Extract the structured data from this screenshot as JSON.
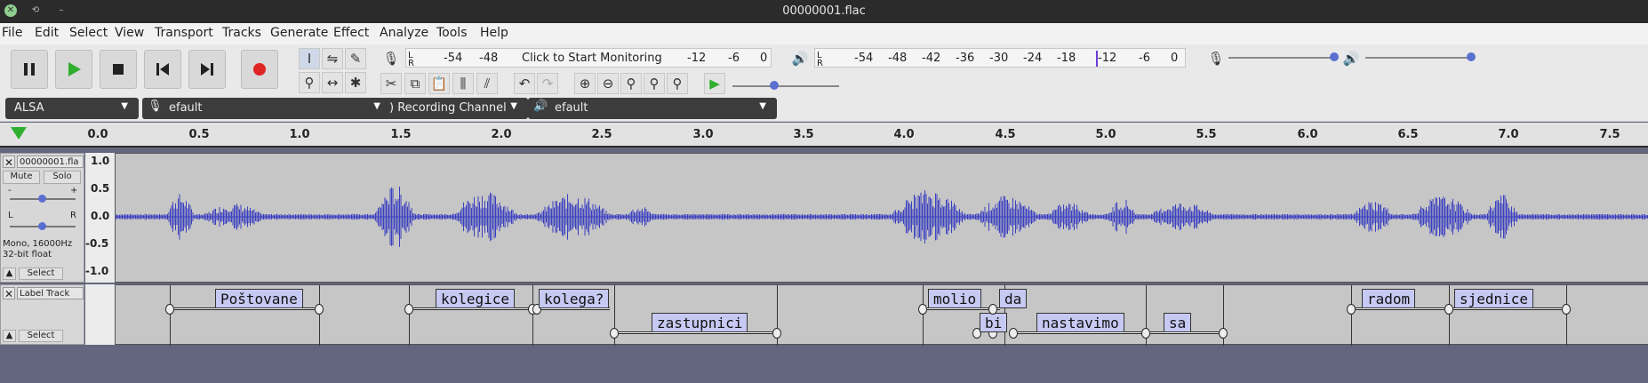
{
  "window": {
    "title": "00000001.flac"
  },
  "menu": [
    "File",
    "Edit",
    "Select",
    "View",
    "Transport",
    "Tracks",
    "Generate",
    "Effect",
    "Analyze",
    "Tools",
    "Help"
  ],
  "meters": {
    "record_prompt": "Click to Start Monitoring",
    "record_ticks": [
      "-54",
      "-48",
      "-12",
      "-6",
      "0"
    ],
    "play_ticks": [
      "-54",
      "-48",
      "-42",
      "-36",
      "-30",
      "-24",
      "-18",
      "-12",
      "-6",
      "0"
    ]
  },
  "devices": {
    "host": "ALSA",
    "input": "efault",
    "channels": ") Recording Channel",
    "output": "efault"
  },
  "ruler": {
    "ticks": [
      "0.0",
      "0.5",
      "1.0",
      "1.5",
      "2.0",
      "2.5",
      "3.0",
      "3.5",
      "4.0",
      "4.5",
      "5.0",
      "5.5",
      "6.0",
      "6.5",
      "7.0",
      "7.5"
    ]
  },
  "audio_track": {
    "name": "00000001.fla",
    "mute": "Mute",
    "solo": "Solo",
    "gain_min": "-",
    "gain_max": "+",
    "pan_left": "L",
    "pan_right": "R",
    "info_line1": "Mono, 16000Hz",
    "info_line2": "32-bit float",
    "select": "Select",
    "scale": [
      "1.0",
      "0.5",
      "0.0",
      "-0.5",
      "-1.0"
    ]
  },
  "label_track": {
    "name": "Label Track",
    "select": "Select",
    "labels": [
      "Poštovane",
      "kolegice",
      "kolega?",
      "zastupnici",
      "molio",
      "bi",
      "da",
      "nastavimo",
      "sa",
      "radom",
      "sjednice"
    ]
  },
  "colors": {
    "waveform": "#3a3fc0",
    "label_fill": "#c6c9f2",
    "background": "#62667f"
  }
}
